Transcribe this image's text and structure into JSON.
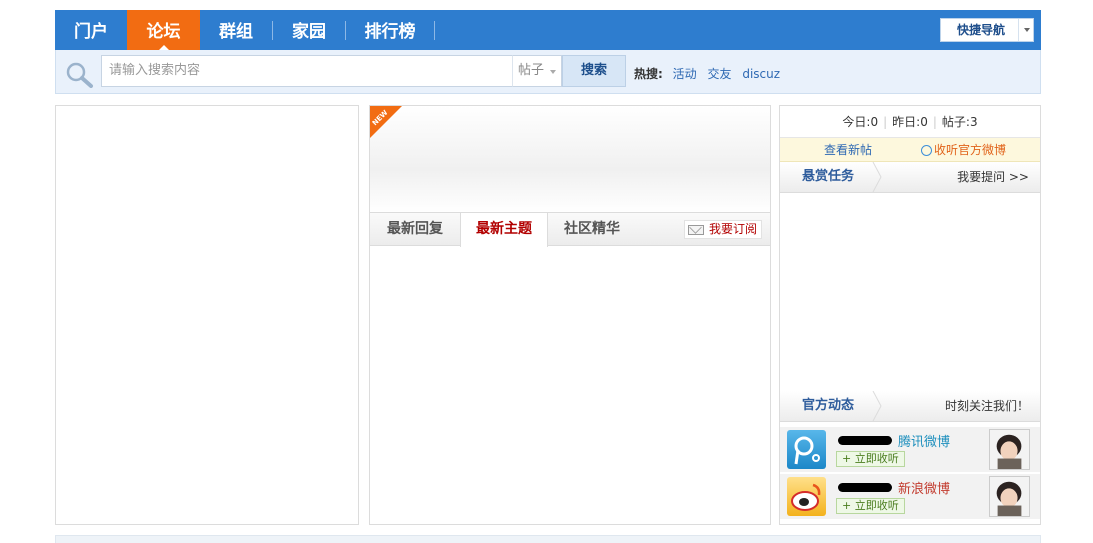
{
  "nav": {
    "items": [
      {
        "label": "门户",
        "active": false
      },
      {
        "label": "论坛",
        "active": true
      },
      {
        "label": "群组",
        "active": false
      },
      {
        "label": "家园",
        "active": false
      },
      {
        "label": "排行榜",
        "active": false
      }
    ],
    "quick_nav_label": "快捷导航",
    "colors": {
      "bar": "#2e7dcf",
      "active": "#f26c12"
    }
  },
  "search": {
    "placeholder": "请输入搜索内容",
    "type_selected": "帖子",
    "button_label": "搜索",
    "hot_label": "热搜:",
    "hot_links": [
      "活动",
      "交友",
      "discuz"
    ]
  },
  "middle": {
    "new_badge": "NEW",
    "tabs": [
      {
        "label": "最新回复",
        "active": false
      },
      {
        "label": "最新主题",
        "active": true
      },
      {
        "label": "社区精华",
        "active": false
      }
    ],
    "subscribe_label": "我要订阅"
  },
  "right": {
    "stats": {
      "today_label": "今日:",
      "today": "0",
      "yesterday_label": "昨日:",
      "yesterday": "0",
      "posts_label": "帖子:",
      "posts": "3"
    },
    "new_posts_link": "查看新帖",
    "weibo_link": "收听官方微博",
    "reward": {
      "title": "悬赏任务",
      "more": "我要提问 >>"
    },
    "official": {
      "title": "官方动态",
      "more": "时刻关注我们！"
    },
    "feeds": [
      {
        "name": "腾讯微博",
        "follow": "+ 立即收听",
        "icon": "tencent-weibo-icon"
      },
      {
        "name": "新浪微博",
        "follow": "+ 立即收听",
        "icon": "sina-weibo-icon"
      }
    ]
  }
}
